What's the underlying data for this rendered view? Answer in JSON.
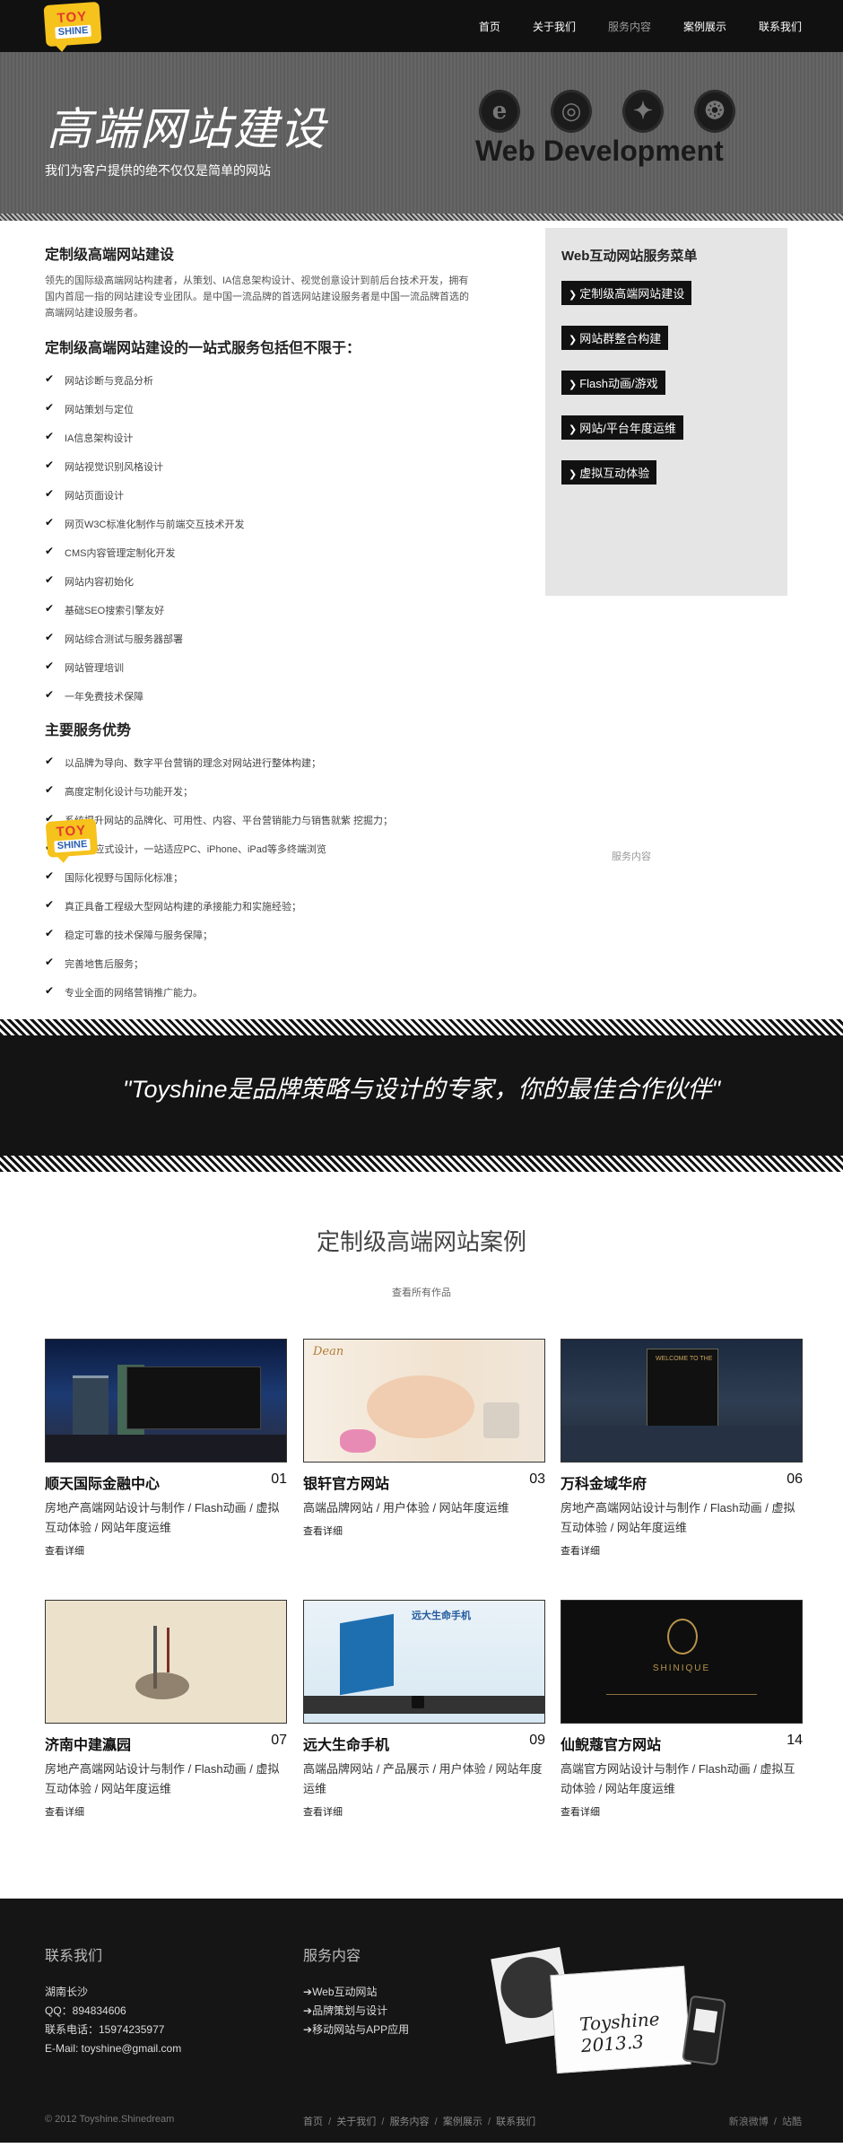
{
  "logo": {
    "line1": "TOY",
    "line2": "SHINE"
  },
  "nav": {
    "items": [
      "首页",
      "关于我们",
      "服务内容",
      "案例展示",
      "联系我们"
    ],
    "active_index": 2
  },
  "banner": {
    "title": "高端网站建设",
    "subtitle": "我们为客户提供的绝不仅仅是简单的网站",
    "tagline": "Web Development"
  },
  "main": {
    "heading": "定制级高端网站建设",
    "intro": "领先的国际级高端网站构建者，从策划、IA信息架构设计、视觉创意设计到前后台技术开发，拥有国内首屈一指的网站建设专业团队。是中国一流品牌的首选网站建设服务者是中国一流品牌首选的高端网站建设服务者。",
    "services_heading": "定制级高端网站建设的一站式服务包括但不限于：",
    "services": [
      "网站诊断与竞品分析",
      "网站策划与定位",
      "IA信息架构设计",
      "网站视觉识别风格设计",
      "网站页面设计",
      "网页W3C标准化制作与前端交互技术开发",
      "CMS内容管理定制化开发",
      "网站内容初始化",
      "基础SEO搜索引擎友好",
      "网站综合测试与服务器部署",
      "网站管理培训",
      "一年免费技术保障"
    ],
    "advantages_heading": "主要服务优势",
    "advantages": [
      "以品牌为导向、数字平台营销的理念对网站进行整体构建；",
      "高度定制化设计与功能开发；",
      "系统提升网站的品牌化、可用性、内容、平台营销能力与销售就紫 挖掘力；",
      "Web响应式设计，一站适应PC、iPhone、iPad等多终端浏览",
      "国际化视野与国际化标准；",
      "真正具备工程级大型网站构建的承接能力和实施经验；",
      "稳定可靠的技术保障与服务保障；",
      "完善地售后服务；",
      "专业全面的网络营销推广能力。"
    ]
  },
  "floating": {
    "label": "服务内容"
  },
  "sidebar": {
    "title": "Web互动网站服务菜单",
    "items": [
      "定制级高端网站建设",
      "网站群整合构建",
      "Flash动画/游戏",
      "网站/平台年度运维",
      "虚拟互动体验"
    ]
  },
  "quote": {
    "text": "\"Toyshine是品牌策略与设计的专家，你的最佳合作伙伴\""
  },
  "cases": {
    "heading": "定制级高端网站案例",
    "all_link": "查看所有作品",
    "more_label": "查看详细",
    "items": [
      {
        "title": "顺天国际金融中心",
        "num": "01",
        "desc": "房地产高端网站设计与制作 / Flash动画 / 虚拟互动体验 / 网站年度运维"
      },
      {
        "title": "银轩官方网站",
        "num": "03",
        "desc": "高端品牌网站 / 用户体验 / 网站年度运维"
      },
      {
        "title": "万科金域华府",
        "num": "06",
        "desc": "房地产高端网站设计与制作 / Flash动画 / 虚拟互动体验 / 网站年度运维"
      },
      {
        "title": "济南中建瀛园",
        "num": "07",
        "desc": "房地产高端网站设计与制作 / Flash动画 / 虚拟互动体验 / 网站年度运维"
      },
      {
        "title": "远大生命手机",
        "num": "09",
        "desc": "高端品牌网站 / 产品展示 / 用户体验 / 网站年度运维"
      },
      {
        "title": "仙鲵蔻官方网站",
        "num": "14",
        "desc": "高端官方网站设计与制作 / Flash动画 / 虚拟互动体验 / 网站年度运维"
      }
    ],
    "thumb_texts": {
      "dean": "Dean",
      "yuanda": "远大生命手机",
      "shinique": "SHINIQUE",
      "welcome": "WELCOME TO THE"
    }
  },
  "footer": {
    "contact_title": "联系我们",
    "contact_lines": [
      "湖南长沙",
      "QQ：894834606",
      "联系电话：15974235977",
      "E-Mail: toyshine@gmail.com"
    ],
    "services_title": "服务内容",
    "services": [
      "Web互动网站",
      "品牌策划与设计",
      "移动网站与APP应用"
    ],
    "copyright": "© 2012 Toyshine.Shinedream",
    "links": [
      "首页",
      "关于我们",
      "服务内容",
      "案例展示",
      "联系我们"
    ],
    "right_links": [
      "新浪微博",
      "站酷"
    ],
    "signature": "Toyshine 2013.3"
  },
  "colors": {
    "accent_dark": "#111111",
    "logo_yellow": "#f6c21c",
    "banner_gray": "#5d5d5d",
    "sidebar_gray": "#e5e5e5"
  }
}
